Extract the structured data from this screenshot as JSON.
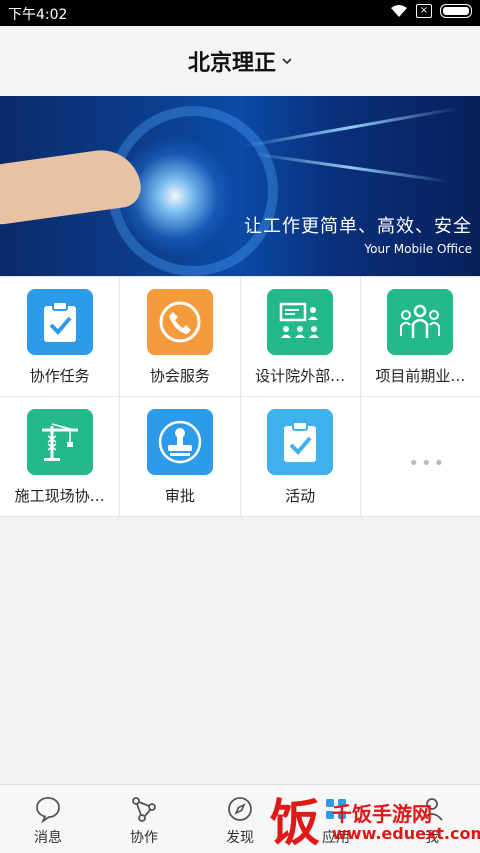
{
  "status_bar": {
    "time": "下午4:02",
    "icons": [
      "wifi-icon",
      "sim-x-icon",
      "battery-icon"
    ]
  },
  "header": {
    "title": "北京理正",
    "dropdown_icon": "chevron-down-icon"
  },
  "banner": {
    "slogan": "让工作更简单、高效、安全",
    "subslogan": "Your Mobile Office"
  },
  "apps": [
    {
      "label": "协作任务",
      "icon": "clipboard-check-icon",
      "color": "#2E9BEA"
    },
    {
      "label": "协会服务",
      "icon": "phone-icon",
      "color": "#F39B3D"
    },
    {
      "label": "设计院外部…",
      "icon": "presentation-people-icon",
      "color": "#23B98A"
    },
    {
      "label": "项目前期业…",
      "icon": "group-people-icon",
      "color": "#23B98A"
    },
    {
      "label": "施工现场协…",
      "icon": "crane-icon",
      "color": "#23B98A"
    },
    {
      "label": "审批",
      "icon": "stamp-icon",
      "color": "#2E9BEA"
    },
    {
      "label": "活动",
      "icon": "clipboard-check-icon",
      "color": "#3FB2EE"
    }
  ],
  "more": {
    "icon": "more-dots-icon",
    "dots": "•••"
  },
  "tabs": [
    {
      "label": "消息",
      "icon": "chat-bubble-icon"
    },
    {
      "label": "协作",
      "icon": "share-nodes-icon"
    },
    {
      "label": "发现",
      "icon": "compass-icon"
    },
    {
      "label": "应用",
      "icon": "apps-icon"
    },
    {
      "label": "我",
      "icon": "person-icon"
    }
  ],
  "watermark": {
    "char": "饭",
    "title": "千饭手游网",
    "url": "www.eduext.com"
  }
}
